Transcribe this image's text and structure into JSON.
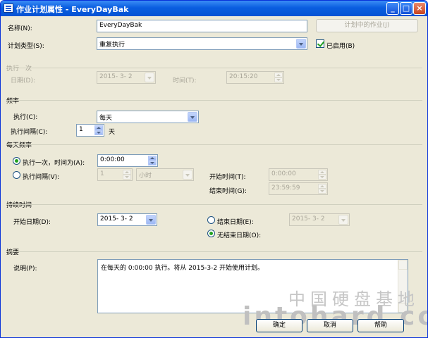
{
  "window": {
    "title": "作业计划属性 - EveryDayBak"
  },
  "name_row": {
    "label": "名称(N):",
    "value": "EveryDayBak",
    "jobs_button": "计划中的作业(J)"
  },
  "schedule_type": {
    "label": "计划类型(S):",
    "value": "重复执行",
    "enabled_label": "已启用(B)",
    "enabled": true
  },
  "once": {
    "group": "执行一次",
    "date_label": "日期(D):",
    "date_value": "2015- 3- 2",
    "time_label": "时间(T):",
    "time_value": "20:15:20"
  },
  "frequency": {
    "group": "频率",
    "exec_label": "执行(C):",
    "exec_value": "每天",
    "interval_label": "执行间隔(C):",
    "interval_value": "1",
    "interval_unit": "天"
  },
  "daily": {
    "group": "每天频率",
    "once_label": "执行一次，时间为(A):",
    "once_value": "0:00:00",
    "once_selected": true,
    "interval_label": "执行间隔(V):",
    "interval_value": "1",
    "interval_unit": "小时",
    "start_label": "开始时间(T):",
    "start_value": "0:00:00",
    "end_label": "结束时间(G):",
    "end_value": "23:59:59"
  },
  "duration": {
    "group": "持续时间",
    "start_label": "开始日期(D):",
    "start_value": "2015- 3- 2",
    "end_label": "结束日期(E):",
    "end_value": "2015- 3- 2",
    "no_end_label": "无结束日期(O):",
    "no_end_selected": true
  },
  "summary": {
    "group": "摘要",
    "desc_label": "说明(P):",
    "desc_text": "在每天的 0:00:00 执行。将从 2015-3-2 开始使用计划。"
  },
  "buttons": {
    "ok": "确定",
    "cancel": "取消",
    "help": "帮助"
  },
  "watermark": {
    "line1": "中国硬盘基地",
    "line2": "intohard.com"
  },
  "colors": {
    "title_bar": "#0a5ee0",
    "dialog_bg": "#ece9d8",
    "check_green": "#21a121"
  }
}
